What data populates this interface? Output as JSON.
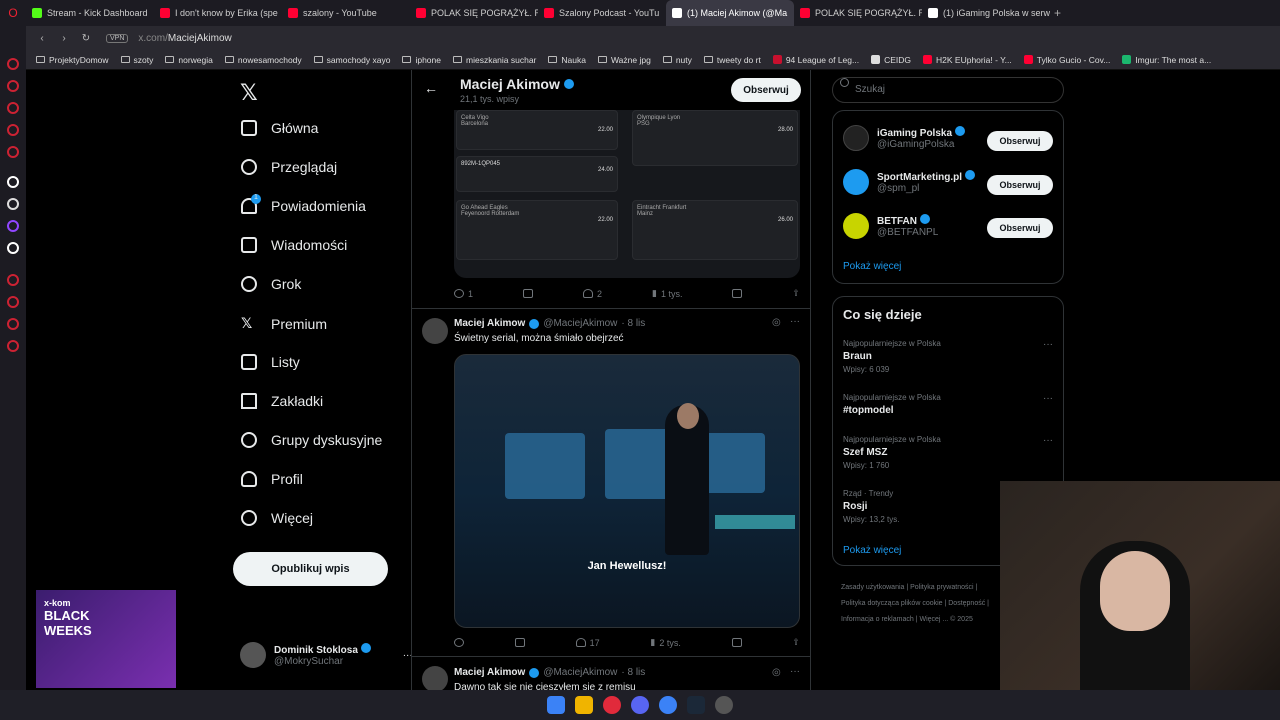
{
  "browser": {
    "tabs": [
      {
        "label": "Stream - Kick Dashboard",
        "color": "#53fc18"
      },
      {
        "label": "I don't know by Erika (spe",
        "color": "#ff0033"
      },
      {
        "label": "szalony - YouTube",
        "color": "#ff0033"
      },
      {
        "label": "POLAK SIĘ POGRĄŻYŁ. R",
        "color": "#ff0033"
      },
      {
        "label": "Szalony Podcast - YouTu",
        "color": "#ff0033"
      },
      {
        "label": "(1) Maciej Akimow (@Ma",
        "color": "#ffffff"
      },
      {
        "label": "POLAK SIĘ POGRĄŻYŁ. R",
        "color": "#ff0033"
      },
      {
        "label": "(1) iGaming Polska w serw",
        "color": "#ffffff"
      }
    ],
    "vpn": "VPN",
    "url_host": "x.com/",
    "url_path": "MaciejAkimow",
    "bookmarks": [
      "ProjektyDomow",
      "szoty",
      "norwegia",
      "nowesamochody",
      "samochody xayo",
      "iphone",
      "mieszkania suchar",
      "Nauka",
      "Ważne jpg",
      "nuty",
      "tweety do rt",
      "94 League of Leg...",
      "CEIDG",
      "H2K EUphoria! - Y...",
      "Tylko Gucio - Cov...",
      "Imgur: The most a..."
    ]
  },
  "nav": {
    "items": [
      "Główna",
      "Przeglądaj",
      "Powiadomienia",
      "Wiadomości",
      "Grok",
      "Premium",
      "Listy",
      "Zakładki",
      "Grupy dyskusyjne",
      "Profil",
      "Więcej"
    ],
    "notif_badge": "1",
    "post_button": "Opublikuj wpis",
    "profile_name": "Dominik Stoklosa",
    "profile_handle": "@MokrySuchar"
  },
  "header": {
    "name": "Maciej Akimow",
    "count": "21,1 tys. wpisy",
    "follow": "Obserwuj",
    "back": "←"
  },
  "slips": [
    {
      "lines": [
        "Celta Vigo",
        "Barcelona"
      ],
      "odds": "22.00"
    },
    {
      "lines": [
        "Olympique Lyon",
        "PSG"
      ],
      "odds": "28.00"
    },
    {
      "lines": [
        "892M-1QP045",
        ""
      ],
      "odds": "24.00"
    },
    {
      "lines": [
        "Go Ahead Eagles",
        "Feyenoord Rotterdam"
      ],
      "odds": "22.00"
    },
    {
      "lines": [
        "Eintracht Frankfurt",
        "Mainz"
      ],
      "odds": "26.00"
    }
  ],
  "tweet1_actions": {
    "reply": "1",
    "like": "2",
    "views": "1 tys."
  },
  "tweet2": {
    "name": "Maciej Akimow",
    "handle": "@MaciejAkimow",
    "time": "· 8 lis",
    "text": "Świetny serial, można śmiało obejrzeć",
    "subtitle": "Jan Hewellusz!",
    "like": "17",
    "views": "2 tys."
  },
  "tweet3": {
    "name": "Maciej Akimow",
    "handle": "@MaciejAkimow",
    "time": "· 8 lis",
    "text": "Dawno tak się nie cieszyłem się z remisu"
  },
  "search": {
    "placeholder": "Szukaj"
  },
  "suggest": [
    {
      "name": "iGaming Polska",
      "handle": "@iGamingPolska",
      "color": "#222"
    },
    {
      "name": "SportMarketing.pl",
      "handle": "@spm_pl",
      "color": "#1d9bf0"
    },
    {
      "name": "BETFAN",
      "handle": "@BETFANPL",
      "color": "#c8d400"
    }
  ],
  "suggest_follow": "Obserwuj",
  "show_more": "Pokaż więcej",
  "trends_title": "Co się dzieje",
  "trends": [
    {
      "cat": "Najpopularniejsze w Polska",
      "title": "Braun",
      "count": "Wpisy: 6 039"
    },
    {
      "cat": "Najpopularniejsze w Polska",
      "title": "#topmodel",
      "count": ""
    },
    {
      "cat": "Najpopularniejsze w Polska",
      "title": "Szef MSZ",
      "count": "Wpisy: 1 760"
    },
    {
      "cat": "Rząd · Trendy",
      "title": "Rosji",
      "count": "Wpisy: 13,2 tys."
    }
  ],
  "footer": "Zasady użytkowania | Polityka prywatności | Polityka dotycząca plików cookie | Dostępność | Informacja o reklamach | Więcej ... © 2025",
  "ad": {
    "brand": "x-kom",
    "line1": "BLACK",
    "line2": "WEEKS"
  }
}
